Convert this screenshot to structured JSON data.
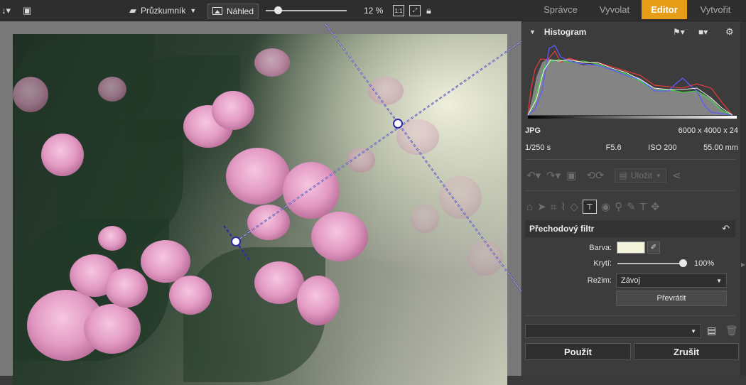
{
  "toolbar": {
    "browser_label": "Průzkumník",
    "preview_label": "Náhled",
    "zoom_value": "12 %",
    "zoom_fraction": 0.15,
    "one_to_one": "1:1"
  },
  "modes": {
    "manager": "Správce",
    "develop": "Vyvolat",
    "editor": "Editor",
    "create": "Vytvořit",
    "accent_color": "#e79d18"
  },
  "histogram": {
    "title": "Histogram"
  },
  "file_info": {
    "format": "JPG",
    "dimensions": "6000 x 4000 x 24",
    "shutter": "1/250 s",
    "aperture": "F5.6",
    "iso": "ISO 200",
    "focal": "55.00 mm"
  },
  "edit_toolbar": {
    "save_label": "Uložit"
  },
  "filter": {
    "title": "Přechodový filtr",
    "color_label": "Barva:",
    "color_value": "#f3f3dc",
    "opacity_label": "Krytí:",
    "opacity_value": "100%",
    "opacity_fraction": 1.0,
    "mode_label": "Režim:",
    "mode_value": "Závoj",
    "invert_label": "Převrátit"
  },
  "preset": {
    "value": ""
  },
  "actions": {
    "apply_label": "Použít",
    "cancel_label": "Zrušit"
  }
}
